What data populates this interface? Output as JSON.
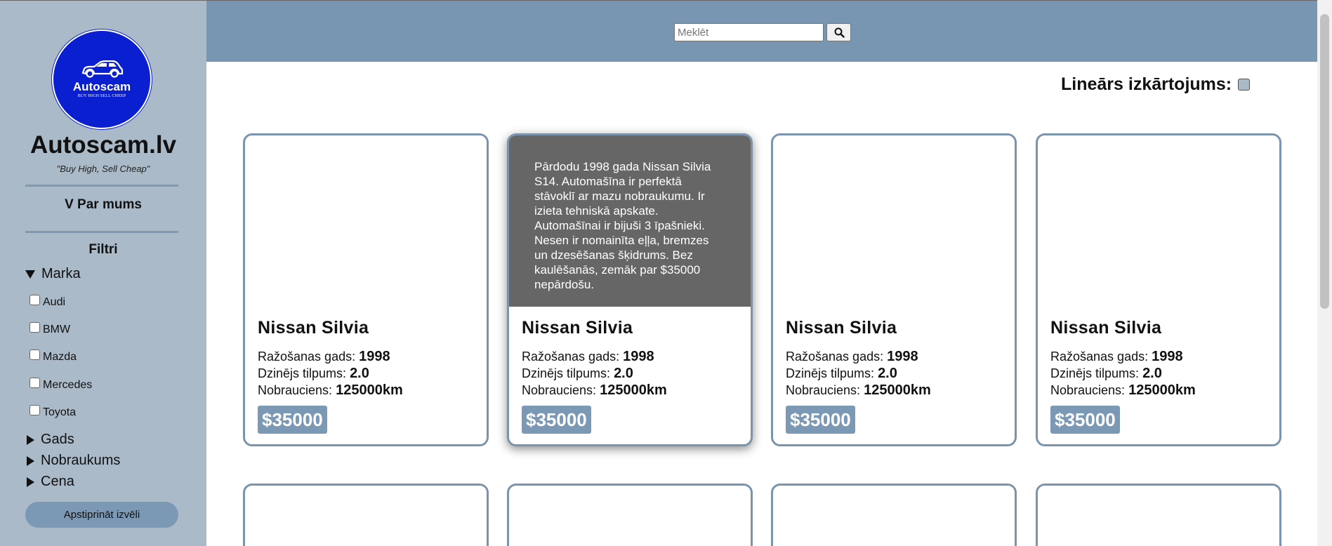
{
  "sidebar": {
    "logo": {
      "name": "Autoscam",
      "tagline": "BUY HIGH SELL CHEEP"
    },
    "title": "Autoscam.lv",
    "motto": "\"Buy High, Sell Cheap\"",
    "about": "V Par mums",
    "filters_title": "Filtri",
    "groups": {
      "brand": "Marka",
      "year": "Gads",
      "mileage": "Nobraukums",
      "price": "Cena"
    },
    "brands": [
      "Audi",
      "BMW",
      "Mazda",
      "Mercedes",
      "Toyota"
    ],
    "confirm_label": "Apstiprināt izvēli"
  },
  "header": {
    "search_placeholder": "Meklēt",
    "search_icon": "search-icon"
  },
  "main": {
    "layout_toggle_label": "Lineārs izkārtojums:",
    "cards": [
      {
        "name": "Nissan Silvia",
        "description": "Pārdodu 1998 gada Nissan Silvia S14. Automašīna ir perfektā stāvoklī ar mazu nobraukumu. Ir izieta tehniskā apskate. Automašīnai ir bijuši 3 īpašnieki. Nesen ir nomainīta eļļa, bremzes un dzesēšanas šķidrums. Bez kaulēšanās, zemāk par $35000 nepārdošu.",
        "year_label": "Ražošanas gads:",
        "year": "1998",
        "engine_label": "Dzinējs tilpums:",
        "engine": "2.0",
        "mileage_label": "Nobrauciens:",
        "mileage": "125000km",
        "price": "$35000"
      }
    ]
  },
  "colors": {
    "sidebar_bg": "#abbac9",
    "header_bg": "#7895b2",
    "accent": "#7b98b5",
    "logo_blue": "#0a1fd0",
    "hover_overlay": "#666666"
  }
}
